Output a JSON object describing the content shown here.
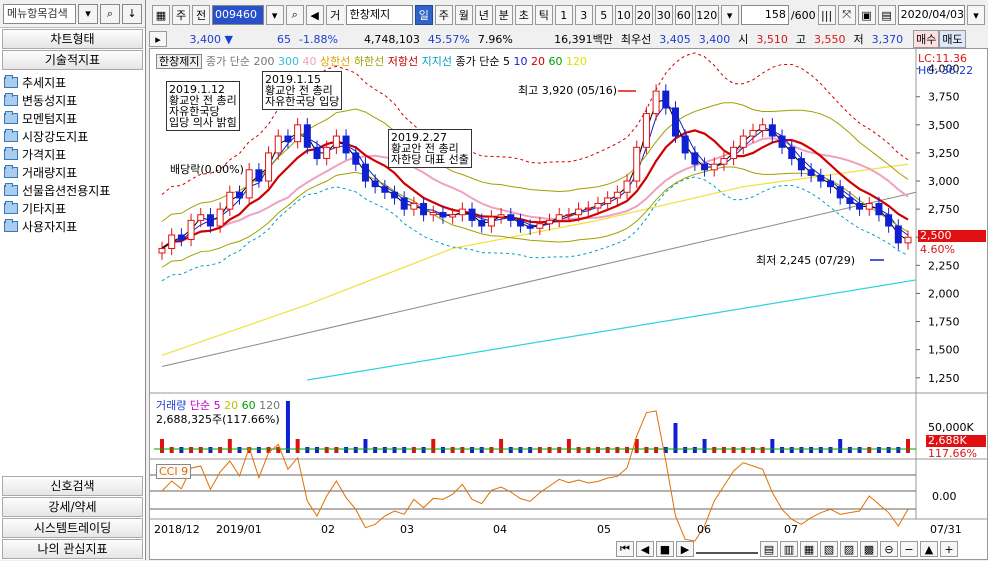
{
  "left_panel": {
    "search_placeholder": "메뉴항목검색",
    "sections": [
      "차트형태",
      "기술적지표"
    ],
    "tree": [
      "추세지표",
      "변동성지표",
      "모멘텀지표",
      "시장강도지표",
      "가격지표",
      "거래량지표",
      "선물옵션전용지표",
      "기타지표",
      "사용자지표"
    ],
    "bottom": [
      "신호검색",
      "강세/약세",
      "시스템트레이딩",
      "나의 관심지표"
    ]
  },
  "toolbar": {
    "period_type": "주",
    "prev": "전",
    "code": "009460",
    "tag": "거",
    "name": "한창제지",
    "periods": [
      "일",
      "주",
      "월",
      "년",
      "분",
      "초",
      "틱"
    ],
    "active_period": "일",
    "numbers": [
      "1",
      "3",
      "5",
      "10",
      "20",
      "30",
      "60",
      "120"
    ],
    "count": "158",
    "count_total": "/600",
    "date": "2020/04/03"
  },
  "quote": {
    "price": "3,400",
    "change": "65",
    "pct": "-1.88%",
    "volume": "4,748,103",
    "rate": "45.57%",
    "rate2": "7.96%",
    "amount": "16,391백만",
    "best": "최우선",
    "ask": "3,405",
    "bid": "3,400",
    "open_label": "시",
    "open": "3,510",
    "high_label": "고",
    "high": "3,550",
    "low_label": "저",
    "low": "3,370",
    "buy": "매수",
    "sell": "매도"
  },
  "price_legend": {
    "name": "한창제지",
    "ma": "종가 단순",
    "ma_periods": [
      "200",
      "300",
      "40"
    ],
    "bands": [
      "상한선",
      "하한선",
      "저항선",
      "지지선"
    ],
    "ma2": "종가 단순",
    "ma2_periods": [
      "5",
      "10",
      "20",
      "60",
      "120"
    ]
  },
  "annotations": [
    {
      "date": "2019.1.12",
      "text": "황교안 전 총리",
      "text2": "자유한국당",
      "text3": "입당 의사 밝힘"
    },
    {
      "date": "2019.1.15",
      "text": "황교안 전 총리",
      "text2": "자유한국당 입당"
    },
    {
      "date": "2019.2.27",
      "text": "황교안 전 총리",
      "text2": "자한당 대표 선출"
    }
  ],
  "dividend_label": "배당락(0.00%)",
  "high_mark": "최고 3,920 (05/16)",
  "low_mark": "최저 2,245 (07/29)",
  "lc": "LC:11.36",
  "hc": "HC:-36.22",
  "price_axis": [
    "4,000",
    "3,750",
    "3,500",
    "3,250",
    "3,000",
    "2,750",
    "2,500",
    "2,250",
    "2,000",
    "1,750",
    "1,500",
    "1,250"
  ],
  "cur_price_box": "2,500",
  "cur_pct_box": "4.60%",
  "volume_legend": {
    "name": "거래량",
    "ma": "단순",
    "periods": [
      "5",
      "20",
      "60",
      "120"
    ],
    "value": "2,688,325주(117.66%)"
  },
  "volume_axis": "50,000K",
  "volume_box": "2,688K",
  "volume_pct": "117.66%",
  "cci_legend": "CCI 9",
  "cci_axis": "0.00",
  "x_axis": [
    "2018/12",
    "2019/01",
    "02",
    "03",
    "04",
    "05",
    "06",
    "07"
  ],
  "x_end": "07/31",
  "colors": {
    "up": "#e01010",
    "down": "#1020d0",
    "ma5": "#ff00ff",
    "ma20": "#d00000",
    "ma60": "#f0a0c0",
    "ma120": "#ffff50",
    "ma200": "#909090",
    "ma300": "#30d0e0"
  },
  "chart_data": {
    "type": "candlestick",
    "price_range": [
      1150,
      4050
    ],
    "months": [
      "2018/12",
      "2019/01",
      "02",
      "03",
      "04",
      "05",
      "06",
      "07"
    ],
    "close": [
      2400,
      2520,
      2480,
      2650,
      2700,
      2600,
      2750,
      2900,
      2850,
      3100,
      3000,
      3250,
      3400,
      3350,
      3500,
      3300,
      3200,
      3300,
      3400,
      3250,
      3150,
      3000,
      2950,
      2900,
      2850,
      2750,
      2800,
      2700,
      2720,
      2680,
      2700,
      2750,
      2650,
      2600,
      2680,
      2700,
      2650,
      2600,
      2580,
      2620,
      2650,
      2700,
      2700,
      2750,
      2760,
      2800,
      2850,
      2900,
      3000,
      3300,
      3600,
      3800,
      3650,
      3400,
      3250,
      3150,
      3100,
      3150,
      3200,
      3300,
      3400,
      3450,
      3500,
      3400,
      3300,
      3200,
      3100,
      3050,
      3000,
      2950,
      2850,
      2800,
      2750,
      2800,
      2700,
      2600,
      2450,
      2500
    ]
  }
}
